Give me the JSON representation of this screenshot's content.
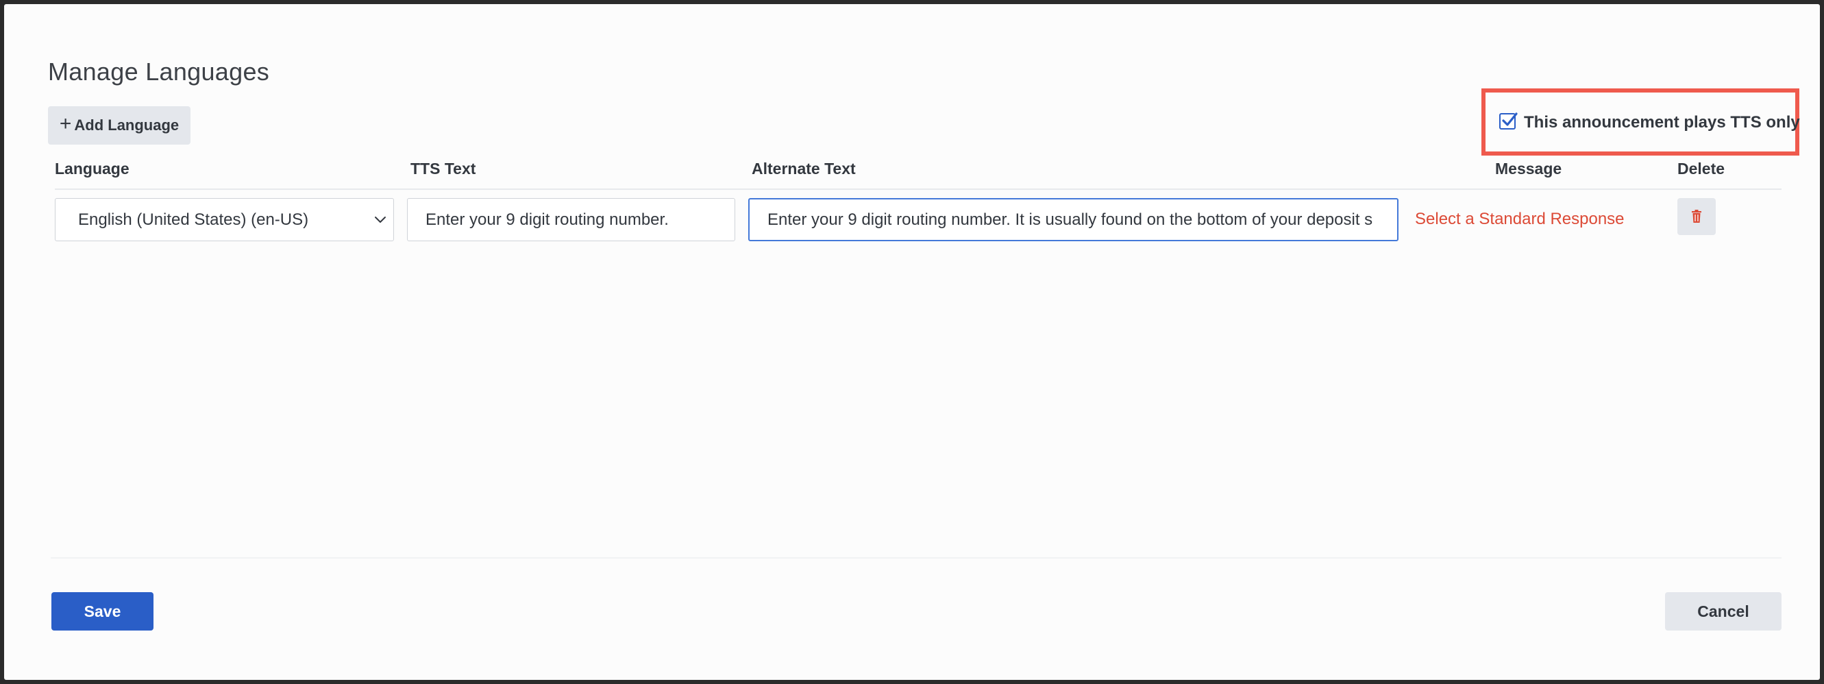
{
  "dialog": {
    "title": "Manage Languages",
    "add_language_label": "Add Language",
    "tts_only_label": "This announcement plays TTS only",
    "tts_only_checked": true,
    "highlight_color": "#ef5a4d"
  },
  "table": {
    "headers": {
      "language": "Language",
      "tts_text": "TTS Text",
      "alternate_text": "Alternate Text",
      "message": "Message",
      "delete": "Delete"
    },
    "rows": [
      {
        "language": "English (United States) (en-US)",
        "tts_text": "Enter your 9 digit routing number.",
        "alternate_text": "Enter your 9 digit routing number. It is usually found on the bottom of your deposit s",
        "message_link": "Select a Standard Response"
      }
    ]
  },
  "footer": {
    "save_label": "Save",
    "cancel_label": "Cancel"
  },
  "colors": {
    "primary": "#2a5ec7",
    "danger_text": "#dc4a36",
    "button_gray": "#e4e7ec"
  },
  "icons": {
    "add": "plus-icon",
    "checkbox": "checkbox-checked-icon",
    "dropdown": "chevron-down-icon",
    "delete": "trash-icon"
  }
}
